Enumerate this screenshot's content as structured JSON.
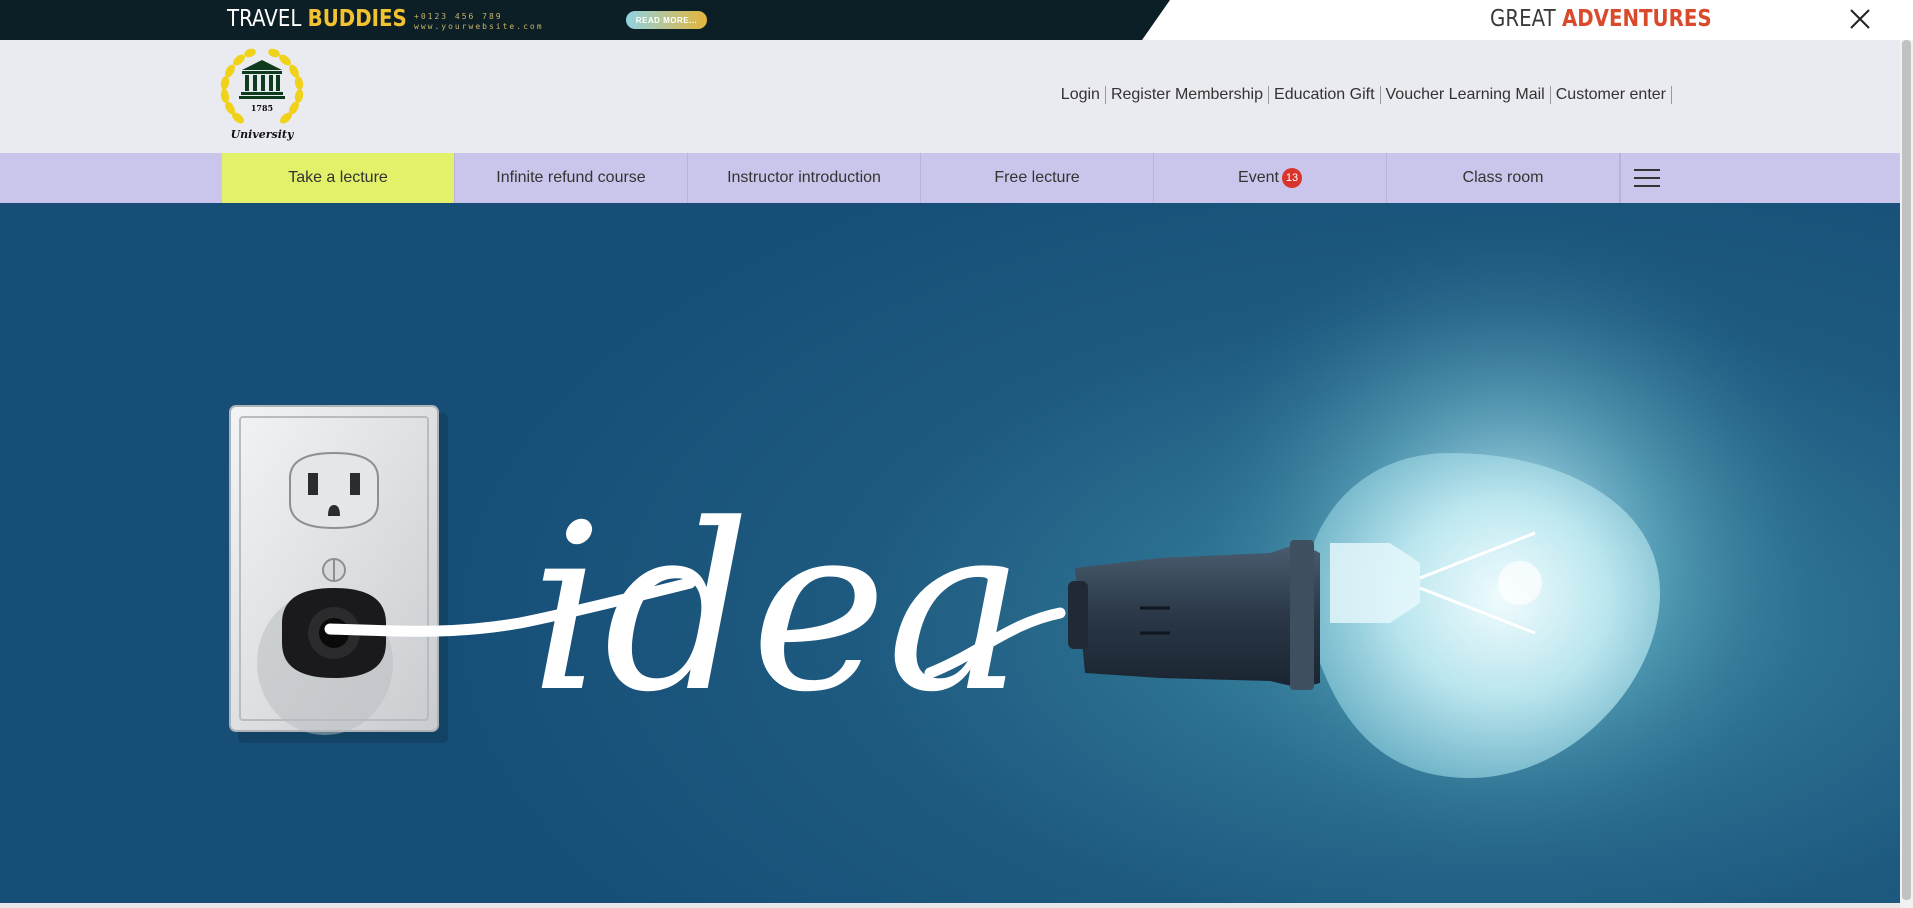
{
  "banner": {
    "title_part1": "TRAVEL ",
    "title_accent": "BUDDIES",
    "phone": "+0123 456 789",
    "website": "www.yourwebsite.com",
    "button_label": "READ MORE...",
    "right_part1": "GREAT ",
    "right_accent": "ADVENTURES",
    "close_icon": "close-icon",
    "dark_color": "#0c1f26",
    "accent_color": "#f2c230",
    "right_accent_color": "#d94a2c"
  },
  "logo": {
    "year": "1785",
    "name": "University"
  },
  "util_nav": [
    {
      "label": "Login"
    },
    {
      "label": "Register Membership"
    },
    {
      "label": "Education Gift"
    },
    {
      "label": "Voucher Learning Mail"
    },
    {
      "label": "Customer enter"
    }
  ],
  "menu": {
    "items": [
      {
        "label": "Take a lecture",
        "active": true
      },
      {
        "label": "Infinite refund course"
      },
      {
        "label": "Instructor introduction"
      },
      {
        "label": "Free lecture"
      },
      {
        "label": "Event",
        "badge": "13"
      },
      {
        "label": "Class room"
      }
    ],
    "menu_icon": "hamburger-menu-icon",
    "bg_color": "#cac6eb",
    "active_color": "#e2f06a",
    "badge_color": "#d9342b"
  },
  "hero": {
    "word": "idea",
    "bg_color": "#1e5a80"
  }
}
